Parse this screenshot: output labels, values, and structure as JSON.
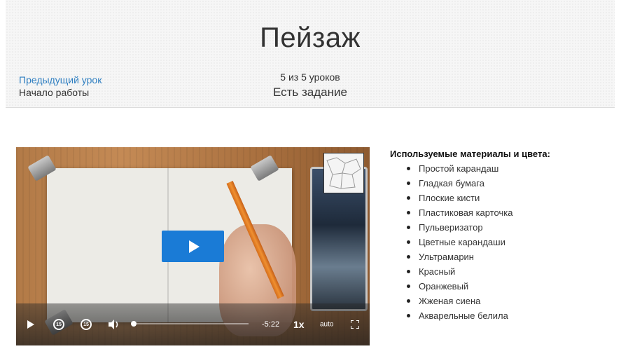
{
  "lesson": {
    "title": "Пейзаж",
    "prev_link": "Предыдущий урок",
    "prev_subtitle": "Начало работы",
    "progress": "5 из 5 уроков",
    "task": "Есть задание"
  },
  "player": {
    "play_icon": "play-icon",
    "back_label": "15",
    "forward_label": "15",
    "time_remaining": "-5:22",
    "speed": "1x",
    "quality": "auto",
    "progress_fraction": 0.0,
    "accent_color": "#1a7bd6"
  },
  "materials": {
    "title": "Используемые материалы и цвета:",
    "items": [
      "Простой карандаш",
      "Гладкая бумага",
      "Плоские кисти",
      "Пластиковая карточка",
      "Пульверизатор",
      "Цветные карандаши",
      "Ультрамарин",
      "Красный",
      "Оранжевый",
      "Жженая сиена",
      "Акварельные белила"
    ]
  },
  "colors": {
    "link": "#2f7fc1",
    "text": "#333333",
    "header_bg": "#f6f6f6"
  }
}
